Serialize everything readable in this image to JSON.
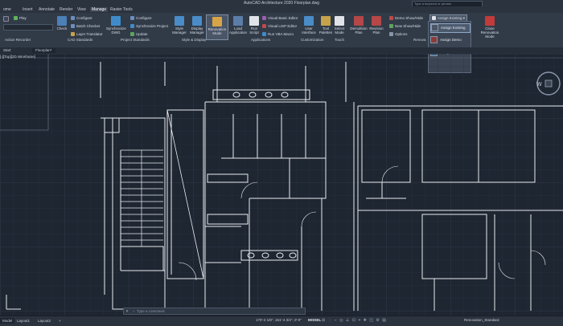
{
  "app": {
    "title": "AutoCAD Architecture 2020   Floorplan.dwg",
    "search_placeholder": "Type a keyword or phrase"
  },
  "tabs": [
    "ome",
    "Insert",
    "Annotate",
    "Render",
    "View",
    "Manage",
    "Raster Tools"
  ],
  "active_tab": "Manage",
  "ribbon": {
    "action_recorder": {
      "play": "Play",
      "panel": "Action Recorder"
    },
    "cad_standards": {
      "check": "Check",
      "configure": "Configure",
      "batch_checker": "Batch Checker",
      "layer_translator": "Layer Translator",
      "panel": "CAD Standards"
    },
    "project_standards": {
      "synchronize_dwg": "Synchronize DWG",
      "configure": "Configure",
      "synchronize_project": "Synchronize Project",
      "update": "Update",
      "panel": "Project Standards"
    },
    "style_display": {
      "style_manager": "Style Manager",
      "display_manager": "Display Manager",
      "renovation_mode": "Renovation Mode",
      "panel": "Style & Display"
    },
    "applications": {
      "load_application": "Load Application",
      "run_script": "Run Script",
      "vb_editor": "Visual Basic Editor",
      "lisp_editor": "Visual LISP Editor",
      "run_vba": "Run VBA Macro",
      "panel": "Applications"
    },
    "customization": {
      "user_interface": "User Interface",
      "tool_palettes": "Tool Palettes",
      "panel": "Customization"
    },
    "touch": {
      "select_mode": "Select Mode",
      "panel": "Touch"
    },
    "renovation": {
      "demolition_plan": "Demolition Plan",
      "revision_plan": "Revision Plan",
      "demo_show_hide": "Demo Show/Hide",
      "new_show_hide": "New Show/Hide",
      "options": "Options",
      "assign_existing": "Assign Existing",
      "close_renovation": "Close Renovation Mode",
      "panel": "Renova"
    }
  },
  "dropdown": [
    "Assign Existing",
    "Assign Demo",
    "Assign New"
  ],
  "doc_tabs": [
    "Start",
    "Floorplan*"
  ],
  "viewport_label": "[-][Top][2D Wireframe]",
  "command_placeholder": "Type a command",
  "status": {
    "layouts": [
      "Model",
      "Layout1",
      "Layout2"
    ],
    "coords": "170'-2 1/8\", 161'-4 3/4\", 0'-0\"",
    "model": "MODEL",
    "config": "Renovation_Standard"
  },
  "colors": {
    "accent": "#e6b84a",
    "canvas": "#1e2632",
    "linework": "#e9ecef"
  }
}
